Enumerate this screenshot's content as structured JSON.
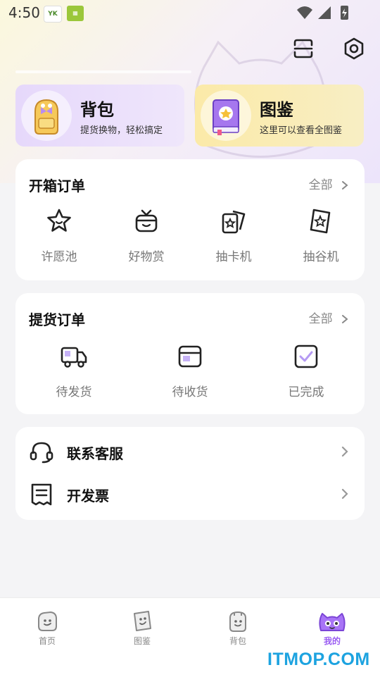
{
  "status_bar": {
    "time": "4:50",
    "app_badge_1": "YK",
    "app_badge_2": "gift"
  },
  "header_icons": {
    "scan": "scan-icon",
    "settings": "settings-icon"
  },
  "top_cards": [
    {
      "title": "背包",
      "subtitle": "提货换物，轻松搞定",
      "icon": "backpack-icon"
    },
    {
      "title": "图鉴",
      "subtitle": "这里可以查看全图鉴",
      "icon": "book-icon"
    }
  ],
  "box_orders": {
    "title": "开箱订单",
    "all_label": "全部",
    "items": [
      {
        "label": "许愿池",
        "icon": "star-icon"
      },
      {
        "label": "好物赏",
        "icon": "gift-icon"
      },
      {
        "label": "抽卡机",
        "icon": "cards-icon"
      },
      {
        "label": "抽谷机",
        "icon": "ticket-icon"
      }
    ]
  },
  "pickup_orders": {
    "title": "提货订单",
    "all_label": "全部",
    "items": [
      {
        "label": "待发货",
        "icon": "truck-icon"
      },
      {
        "label": "待收货",
        "icon": "package-icon"
      },
      {
        "label": "已完成",
        "icon": "check-icon"
      }
    ]
  },
  "service_list": [
    {
      "label": "联系客服",
      "icon": "headset-icon"
    },
    {
      "label": "开发票",
      "icon": "invoice-icon"
    }
  ],
  "tabs": [
    {
      "label": "首页",
      "icon": "home-tab-icon",
      "active": false
    },
    {
      "label": "图鉴",
      "icon": "book-tab-icon",
      "active": false
    },
    {
      "label": "背包",
      "icon": "bag-tab-icon",
      "active": false
    },
    {
      "label": "我的",
      "icon": "profile-tab-icon",
      "active": true
    }
  ],
  "colors": {
    "accent": "#9a5cf2",
    "bag_card": "#e6d8fb",
    "book_card": "#fbeaa8",
    "background": "#f4f4f6"
  },
  "watermark": "ITMOP.COM"
}
